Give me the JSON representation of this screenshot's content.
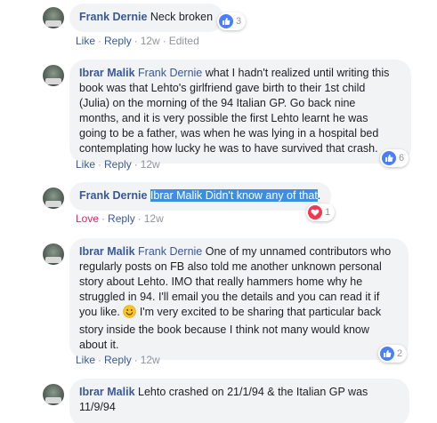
{
  "comments": [
    {
      "author": "Frank Dernie",
      "text": "Neck broken",
      "actions": {
        "like": "Like",
        "reply": "Reply",
        "time": "12w",
        "edited": "Edited"
      },
      "reaction_count": "3"
    },
    {
      "author": "Ibrar Malik",
      "mention": "Frank Dernie",
      "lines": [
        " what I hadn't realized until writing this",
        "book was that Lehto's girlfriend gave birth to their 1st child",
        "(Julia) on the morning of the 94 Italian GP. Go back nine",
        "months, and it is very possible the first Lehto learnt he was",
        "going to be a father, was when he was lying in a hospital bed",
        "contemplating how lucky he was to have survived that crash."
      ],
      "actions": {
        "like": "Like",
        "reply": "Reply",
        "time": "12w"
      },
      "reaction_count": "6"
    },
    {
      "author": "Frank Dernie",
      "mention": "Ibrar Malik",
      "text": " Didn't know any of that",
      "end": ".",
      "actions": {
        "like": "Love",
        "reply": "Reply",
        "time": "12w"
      },
      "reaction_count": "1"
    },
    {
      "author": "Ibrar Malik",
      "mention": "Frank Dernie",
      "lines": [
        " One of my unnamed contributors who",
        "regularly posts on FB also told me another unknown personal",
        "story about Lehto. IMO that really hammers home why he",
        "struggled in 94. I'll email you the details and you can read it if",
        "you like.",
        " I'm very excited to be sharing that particular back",
        "story inside the book because I think not many would know",
        "about it."
      ],
      "actions": {
        "like": "Like",
        "reply": "Reply",
        "time": "12w"
      },
      "reaction_count": "2"
    },
    {
      "author": "Ibrar Malik",
      "lines": [
        " Lehto crashed on 21/1/94 & the Italian GP was",
        "11/9/94"
      ]
    }
  ],
  "separator": "·",
  "colors": {
    "link": "#385898",
    "bubble": "#f2f3f5",
    "like": "#4a7ff5",
    "love": "#f0384f",
    "selection": "#3e8ee0"
  }
}
